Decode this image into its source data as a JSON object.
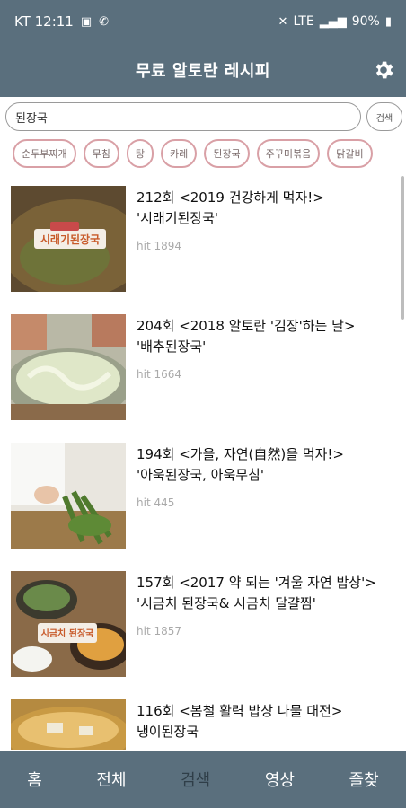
{
  "status": {
    "carrier_time": "KT 12:11",
    "network": "LTE",
    "battery": "90%"
  },
  "header": {
    "title": "무료 알토란 레시피"
  },
  "search": {
    "value": "된장국",
    "button_label": "검색"
  },
  "chips": [
    "순두부찌개",
    "무침",
    "탕",
    "카레",
    "된장국",
    "주꾸미볶음",
    "닭갈비"
  ],
  "items": [
    {
      "line1": "212회 <2019 건강하게 먹자!>",
      "line2": "'시래기된장국'",
      "hit": "hit 1894",
      "caption": "시래기된장국",
      "bg": "#6b5a3a",
      "accent": "#c85a2a"
    },
    {
      "line1": "204회 <2018 알토란 '김장'하는 날>",
      "line2": "'배추된장국'",
      "hit": "hit 1664",
      "caption": "",
      "bg": "#c7c9b8",
      "accent": "#dfe7c8"
    },
    {
      "line1": "194회 <가을, 자연(自然)을 먹자!>",
      "line2": "'아욱된장국, 아욱무침'",
      "hit": "hit 445",
      "caption": "",
      "bg": "#e9e6df",
      "accent": "#4f7a2e"
    },
    {
      "line1": "157회 <2017 약 되는 '겨울 자연 밥상'>",
      "line2": "'시금치 된장국& 시금치 달걀찜'",
      "hit": "hit 1857",
      "caption": "시금치 된장국",
      "bg": "#8a6a48",
      "accent": "#e0a040"
    },
    {
      "line1": "116회 <봄철 활력 밥상 나물 대전>",
      "line2": "냉이된장국",
      "hit": "",
      "caption": "",
      "bg": "#c99a44",
      "accent": "#e8c070"
    }
  ],
  "nav": [
    "홈",
    "전체",
    "검색",
    "영상",
    "즐찾"
  ],
  "colors": {
    "primary": "#5a6f7d",
    "chip_border": "#d9a0a6",
    "nav_active": "#2f3e48"
  }
}
